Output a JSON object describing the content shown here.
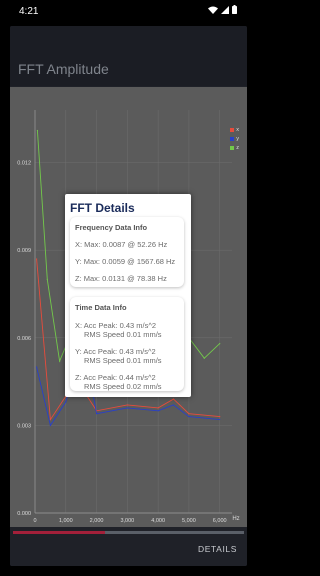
{
  "status": {
    "time": "4:21"
  },
  "app": {
    "title": "FFT Amplitude"
  },
  "chart_data": {
    "type": "line",
    "xlabel": "Hz",
    "ylabel": "",
    "x_ticks": [
      "0",
      "1,000",
      "2,000",
      "3,000",
      "4,000",
      "5,000",
      "6,000"
    ],
    "y_ticks": [
      "0.000",
      "0.003",
      "0.006",
      "0.009",
      "0.012"
    ],
    "xlim": [
      0,
      6400
    ],
    "ylim": [
      0,
      0.0138
    ],
    "legend_position": "top-right",
    "series": [
      {
        "name": "x",
        "color": "#e74c3c",
        "x": [
          52.26,
          500,
          1000,
          1567.68,
          2000,
          3000,
          4000,
          4500,
          5000,
          6000
        ],
        "y": [
          0.0087,
          0.0032,
          0.004,
          0.0042,
          0.0035,
          0.0037,
          0.0036,
          0.0039,
          0.0034,
          0.0033
        ]
      },
      {
        "name": "y",
        "color": "#2940c8",
        "x": [
          52.26,
          500,
          1000,
          1567.68,
          2000,
          3000,
          4000,
          4500,
          5000,
          6000
        ],
        "y": [
          0.005,
          0.003,
          0.0038,
          0.0059,
          0.0034,
          0.0036,
          0.0035,
          0.0037,
          0.0033,
          0.0032
        ]
      },
      {
        "name": "z",
        "color": "#73c94b",
        "x": [
          78.38,
          400,
          800,
          1200,
          1600,
          2000,
          3000,
          4000,
          4500,
          5000,
          5500,
          6000
        ],
        "y": [
          0.0131,
          0.008,
          0.0052,
          0.0062,
          0.0058,
          0.0055,
          0.0057,
          0.0056,
          0.0063,
          0.006,
          0.0053,
          0.0058
        ]
      }
    ]
  },
  "dialog": {
    "title": "FFT Details",
    "frequency": {
      "heading": "Frequency Data Info",
      "x": "X: Max: 0.0087 @ 52.26 Hz",
      "y": "Y: Max: 0.0059 @ 1567.68 Hz",
      "z": "Z: Max: 0.0131 @ 78.38 Hz"
    },
    "time": {
      "heading": "Time Data Info",
      "x1": "X: Acc Peak: 0.43 m/s^2",
      "x2": "RMS Speed 0.01 mm/s",
      "y1": "Y: Acc Peak: 0.43 m/s^2",
      "y2": "RMS Speed 0.01 mm/s",
      "z1": "Z: Acc Peak: 0.44 m/s^2",
      "z2": "RMS Speed 0.02 mm/s"
    }
  },
  "bottom": {
    "details_label": "DETAILS",
    "progress": 0.4
  }
}
